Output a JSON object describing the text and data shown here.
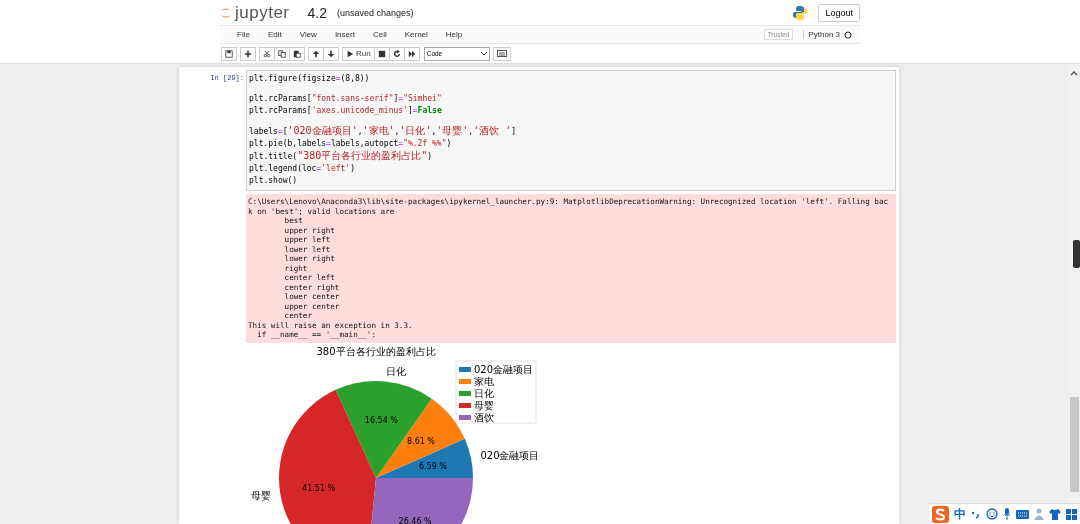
{
  "header": {
    "logo_text": "jupyter",
    "notebook_name": "4.2",
    "save_status": "(unsaved changes)",
    "logout_button": "Logout"
  },
  "menubar": {
    "items": [
      "File",
      "Edit",
      "View",
      "Insert",
      "Cell",
      "Kernel",
      "Help"
    ],
    "trusted": "Trusted",
    "kernel_name": "Python 3",
    "kernel_busy": false
  },
  "toolbar": {
    "run_label": "Run",
    "cell_type": "Code"
  },
  "cell": {
    "prompt": "In [29]:",
    "code_lines": [
      {
        "kind": "code",
        "segments": [
          {
            "kind": "plain",
            "text": "plt.figure(figsize"
          },
          {
            "kind": "op",
            "text": "="
          },
          {
            "kind": "plain",
            "text": "(8,8))"
          }
        ]
      },
      {
        "kind": "blank"
      },
      {
        "kind": "code",
        "segments": [
          {
            "kind": "plain",
            "text": "plt.rcParams["
          },
          {
            "kind": "string",
            "text": "\"font.sans-serif\""
          },
          {
            "kind": "plain",
            "text": "]"
          },
          {
            "kind": "op",
            "text": "="
          },
          {
            "kind": "string",
            "text": "\"Simhei\""
          }
        ]
      },
      {
        "kind": "code",
        "segments": [
          {
            "kind": "plain",
            "text": "plt.rcParams["
          },
          {
            "kind": "string",
            "text": "'axes.unicode_minus'"
          },
          {
            "kind": "plain",
            "text": "]"
          },
          {
            "kind": "op",
            "text": "="
          },
          {
            "kind": "keyword",
            "text": "False"
          }
        ]
      },
      {
        "kind": "blank"
      },
      {
        "kind": "code",
        "segments": [
          {
            "kind": "plain",
            "text": "labels"
          },
          {
            "kind": "op",
            "text": "="
          },
          {
            "kind": "plain",
            "text": "["
          },
          {
            "kind": "string",
            "text": "'020金融项目'"
          },
          {
            "kind": "plain",
            "text": ","
          },
          {
            "kind": "string",
            "text": "'家电'"
          },
          {
            "kind": "plain",
            "text": ","
          },
          {
            "kind": "string",
            "text": "'日化'"
          },
          {
            "kind": "plain",
            "text": ","
          },
          {
            "kind": "string",
            "text": "'母婴'"
          },
          {
            "kind": "plain",
            "text": ","
          },
          {
            "kind": "string",
            "text": "'酒饮 '"
          },
          {
            "kind": "plain",
            "text": "]"
          }
        ]
      },
      {
        "kind": "code",
        "segments": [
          {
            "kind": "plain",
            "text": "plt.pie(b,labels"
          },
          {
            "kind": "op",
            "text": "="
          },
          {
            "kind": "plain",
            "text": "labels,autopct"
          },
          {
            "kind": "op",
            "text": "="
          },
          {
            "kind": "string",
            "text": "\"%.2f %%\""
          },
          {
            "kind": "plain",
            "text": ")"
          }
        ]
      },
      {
        "kind": "code",
        "segments": [
          {
            "kind": "plain",
            "text": "plt.title("
          },
          {
            "kind": "string",
            "text": "\"380平台各行业的盈利占比\""
          },
          {
            "kind": "plain",
            "text": ")"
          }
        ]
      },
      {
        "kind": "code",
        "segments": [
          {
            "kind": "plain",
            "text": "plt.legend(loc"
          },
          {
            "kind": "op",
            "text": "="
          },
          {
            "kind": "string",
            "text": "'left'"
          },
          {
            "kind": "plain",
            "text": ")"
          }
        ]
      },
      {
        "kind": "code",
        "segments": [
          {
            "kind": "plain",
            "text": "plt.show()"
          }
        ]
      }
    ],
    "stderr_lines": [
      "C:\\Users\\Lenovo\\Anaconda3\\lib\\site-packages\\ipykernel_launcher.py:9: MatplotlibDeprecationWarning: Unrecognized location 'left'. Falling bac",
      "k on 'best'; valid locations are",
      "\tbest",
      "\tupper right",
      "\tupper left",
      "\tlower left",
      "\tlower right",
      "\tright",
      "\tcenter left",
      "\tcenter right",
      "\tlower center",
      "\tupper center",
      "\tcenter",
      "This will raise an exception in 3.3.",
      "  if __name__ == '__main__':"
    ],
    "chart_data": {
      "type": "pie",
      "title": "380平台各行业的盈利占比",
      "categories": [
        "020金融项目",
        "家电",
        "日化",
        "母婴",
        "酒饮"
      ],
      "values": [
        6.59,
        8.61,
        16.54,
        41.51,
        26.46
      ],
      "colors": [
        "#1f77b4",
        "#ff7f0e",
        "#2ca02c",
        "#d62728",
        "#9467bd"
      ],
      "legend": "upper right",
      "value_labels": [
        "6.59 %",
        "8.61 %",
        "16.54 %",
        "41.51 %",
        "26.46 %"
      ]
    }
  },
  "ime_bar": {
    "mode": "中"
  }
}
